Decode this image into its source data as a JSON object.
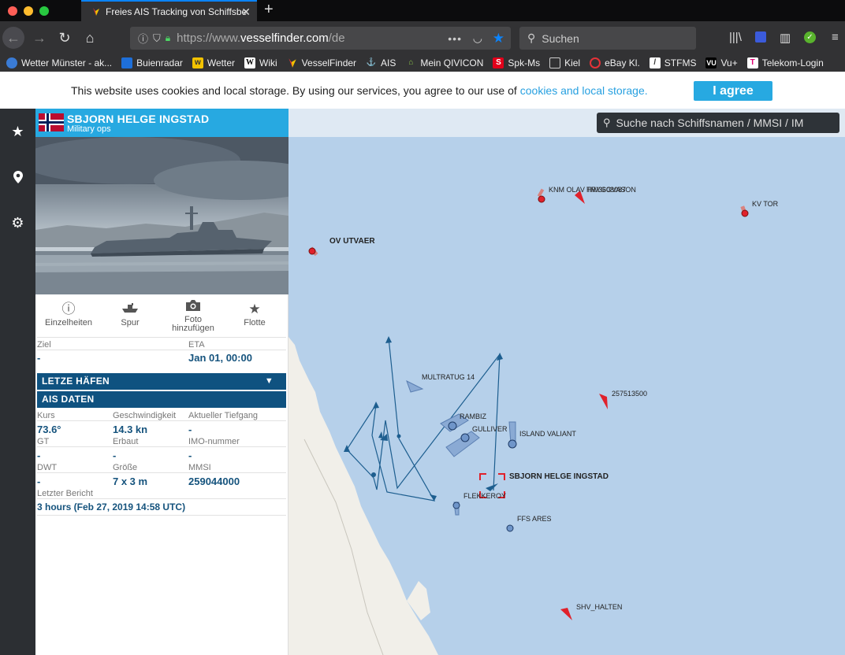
{
  "browser": {
    "tab_title": "Freies AIS Tracking von Schiffsbewegungen",
    "url_prefix": "https://www.",
    "url_domain": "vesselfinder.com",
    "url_path": "/de",
    "search_placeholder": "Suchen"
  },
  "bookmarks": [
    {
      "label": "Wetter Münster - ak...",
      "icon": "weather-icon",
      "color": "#3a7bd5"
    },
    {
      "label": "Buienradar",
      "icon": "buienradar-icon",
      "color": "#1e6fd9"
    },
    {
      "label": "Wetter",
      "icon": "wetter-icon",
      "color": "#f2c200"
    },
    {
      "label": "Wiki",
      "icon": "wikipedia-icon",
      "color": "#ffffff"
    },
    {
      "label": "VesselFinder",
      "icon": "vesselfinder-icon",
      "color": "#e8b000"
    },
    {
      "label": "AIS",
      "icon": "ais-icon",
      "color": "#3aa0e0"
    },
    {
      "label": "Mein QIVICON",
      "icon": "qivicon-icon",
      "color": "#8bc34a"
    },
    {
      "label": "Spk-Ms",
      "icon": "sparkasse-icon",
      "color": "#e2001a"
    },
    {
      "label": "Kiel",
      "icon": "folder-icon",
      "color": "#cccccc"
    },
    {
      "label": "eBay Kl.",
      "icon": "ebay-icon",
      "color": "#e53238"
    },
    {
      "label": "STFMS",
      "icon": "stfms-icon",
      "color": "#ffffff"
    },
    {
      "label": "Vu+",
      "icon": "vuplus-icon",
      "color": "#000000"
    },
    {
      "label": "Telekom-Login",
      "icon": "telekom-icon",
      "color": "#e20074"
    }
  ],
  "cookie": {
    "text": "This website uses cookies and local storage. By using our services, you agree to our use of",
    "link": "cookies and local storage.",
    "button": "I agree"
  },
  "ship": {
    "name": "SBJORN HELGE INGSTAD",
    "type": "Military ops",
    "flag": "Norway",
    "actions": {
      "details": "Einzelheiten",
      "track": "Spur",
      "photo_line1": "Foto",
      "photo_line2": "hinzufügen",
      "fleet": "Flotte"
    },
    "labels": {
      "destination": "Ziel",
      "eta": "ETA",
      "course": "Kurs",
      "speed": "Geschwindigkeit",
      "draught": "Aktueller Tiefgang",
      "gt": "GT",
      "built": "Erbaut",
      "imo": "IMO-nummer",
      "dwt": "DWT",
      "size": "Größe",
      "mmsi": "MMSI",
      "last_report": "Letzter Bericht"
    },
    "destination": "-",
    "eta": "Jan 01, 00:00",
    "last_ports_title": "LETZE HÄFEN",
    "ais_title": "AIS DATEN",
    "course": "73.6°",
    "speed": "14.3 kn",
    "draught": "-",
    "gt": "-",
    "built": "-",
    "imo": "-",
    "dwt": "-",
    "size": "7 x 3 m",
    "mmsi": "259044000",
    "last_report": "3 hours (Feb 27, 2019 14:58 UTC)"
  },
  "map": {
    "search_placeholder": "Suche nach Schiffsnamen / MMSI / IM",
    "vessels": {
      "knm_olav": "KNM OLAV TRYGGVASON",
      "knm_olav_overlap": "HW3608087",
      "kv_tor": "KV TOR",
      "ov_utvaer": "OV UTVAER",
      "multratug": "MULTRATUG 14",
      "v257513500": "257513500",
      "rambiz": "RAMBIZ",
      "gulliver": "GULLIVER",
      "island_valiant": "ISLAND VALIANT",
      "sbjorn": "SBJORN HELGE INGSTAD",
      "flekkeroy": "FLEKKEROY",
      "ffs_ares": "FFS ARES",
      "shv_halten": "SHV_HALTEN"
    },
    "colors": {
      "sea": "#b6d0ea",
      "land": "#f1efe9",
      "track": "#1d5e8f",
      "vessel_red": "#e0212b",
      "vessel_blue": "#6f95c9"
    }
  }
}
